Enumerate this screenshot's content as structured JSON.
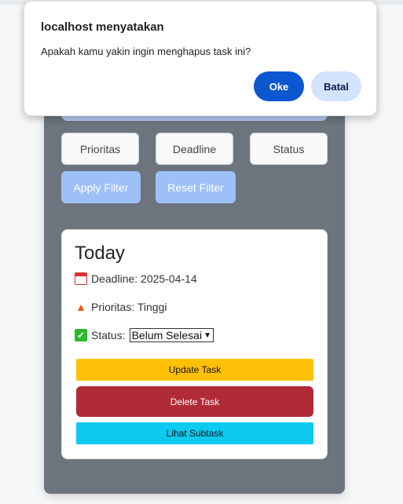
{
  "dialog": {
    "title": "localhost menyatakan",
    "message": "Apakah kamu yakin ingin menghapus task ini?",
    "ok_label": "Oke",
    "cancel_label": "Batal"
  },
  "sort": {
    "buttons": [
      "Prioritas",
      "Deadline",
      "Status"
    ]
  },
  "filter": {
    "apply_label": "Apply Filter",
    "reset_label": "Reset Filter"
  },
  "task": {
    "title": "Today",
    "deadline_text": "Deadline: 2025-04-14",
    "priority_text": "Prioritas: Tinggi",
    "status_label": "Status:",
    "status_value": "Belum Selesai",
    "update_label": "Update Task",
    "delete_label": "Delete Task",
    "subtask_label": "Lihat Subtask"
  },
  "icons": {
    "deadline": "calendar-icon",
    "priority": "fire-icon",
    "status": "check-box-icon"
  },
  "colors": {
    "panel": "#6c757d",
    "primary_light": "#9ec0f8",
    "warning": "#ffc107",
    "danger": "#b02a37",
    "info": "#0dcaf0",
    "dialog_ok": "#0b57d0"
  }
}
